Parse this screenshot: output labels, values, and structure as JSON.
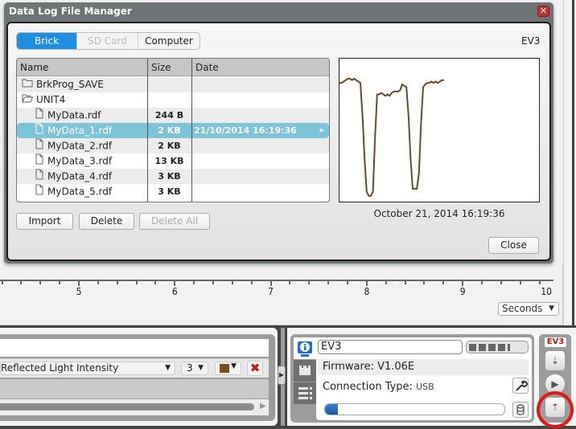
{
  "dialog": {
    "title": "Data Log File Manager",
    "tabs": [
      {
        "label": "Brick",
        "state": "active"
      },
      {
        "label": "SD Card",
        "state": "disabled"
      },
      {
        "label": "Computer",
        "state": "normal"
      }
    ],
    "target": "EV3",
    "table": {
      "columns": [
        "Name",
        "Size",
        "Date"
      ],
      "rows": [
        {
          "type": "folder",
          "name": "BrkProg_SAVE",
          "size": "",
          "date": ""
        },
        {
          "type": "folder-open",
          "name": "UNIT4",
          "size": "",
          "date": ""
        },
        {
          "type": "file",
          "name": "MyData.rdf",
          "size": "244 B",
          "date": ""
        },
        {
          "type": "file",
          "name": "MyData_1.rdf",
          "size": "2 KB",
          "date": "21/10/2014 16:19:36",
          "selected": true
        },
        {
          "type": "file",
          "name": "MyData_2.rdf",
          "size": "2 KB",
          "date": ""
        },
        {
          "type": "file",
          "name": "MyData_3.rdf",
          "size": "13 KB",
          "date": ""
        },
        {
          "type": "file",
          "name": "MyData_4.rdf",
          "size": "3 KB",
          "date": ""
        },
        {
          "type": "file",
          "name": "MyData_5.rdf",
          "size": "3 KB",
          "date": ""
        }
      ]
    },
    "buttons": {
      "import": "Import",
      "delete": "Delete",
      "delete_all": "Delete All",
      "close": "Close"
    },
    "preview": {
      "date_label": "October 21, 2014 16:19:36",
      "line_color": "#6b4a2b",
      "y_values": [
        17,
        17,
        16,
        15,
        14,
        14,
        15,
        14,
        15,
        16,
        17,
        40,
        70,
        93,
        96,
        96,
        93,
        55,
        25,
        25,
        24,
        25,
        26,
        25,
        26,
        24,
        23,
        23,
        23,
        22,
        18,
        19,
        20,
        40,
        70,
        91,
        91,
        91,
        80,
        45,
        20,
        18,
        17,
        17,
        16,
        17,
        16,
        17,
        16,
        15,
        15
      ]
    }
  },
  "graph": {
    "x_ticks": [
      "5",
      "6",
      "7",
      "8",
      "9",
      "10"
    ],
    "units": "Seconds"
  },
  "sensor_panel": {
    "mode": "Reflected Light Intensity",
    "port": "3",
    "color": "#7a4a1e"
  },
  "hardware": {
    "brick_name": "EV3",
    "firmware": "Firmware: V1.06E",
    "connection_label": "Connection Type:",
    "connection_value": "USB",
    "battery_cells": 4,
    "memory_used_fraction": 0.07,
    "badge": "EV3"
  }
}
